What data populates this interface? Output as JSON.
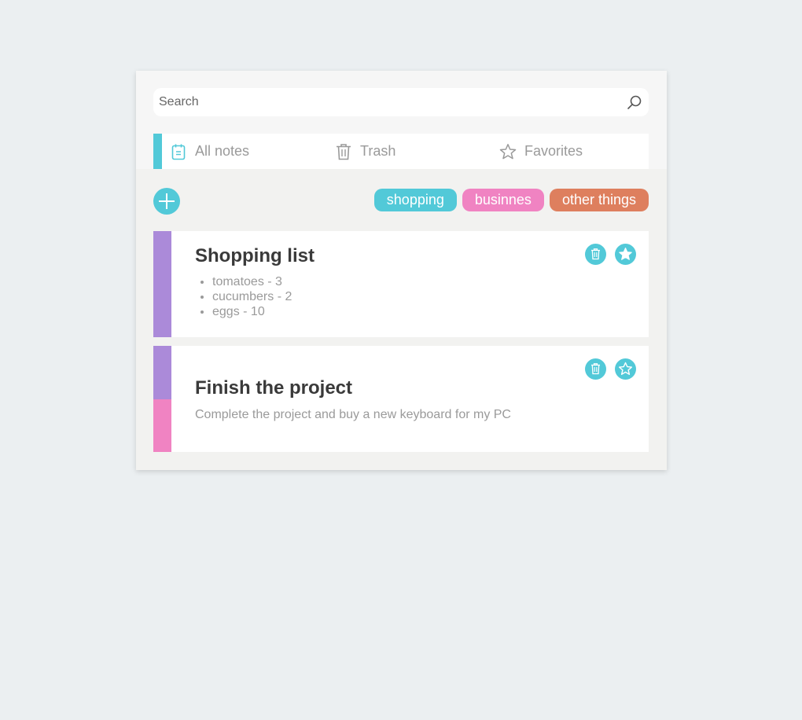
{
  "search": {
    "placeholder": "Search",
    "icon": "search-icon"
  },
  "nav": {
    "items": [
      {
        "label": "All notes",
        "icon": "notepad-icon",
        "active": true
      },
      {
        "label": "Trash",
        "icon": "trash-icon",
        "active": false
      },
      {
        "label": "Favorites",
        "icon": "star-icon",
        "active": false
      }
    ]
  },
  "toolbar": {
    "add_icon": "plus-icon"
  },
  "tags": [
    {
      "label": "shopping",
      "color": "#52c9d8"
    },
    {
      "label": "businnes",
      "color": "#f083c2"
    },
    {
      "label": "other things",
      "color": "#de7f5e"
    }
  ],
  "notes": [
    {
      "title": "Shopping list",
      "items": [
        "tomatoes - 3",
        "cucumbers - 2",
        "eggs - 10"
      ],
      "strip_colors": [
        "#ab8ad9"
      ],
      "favorite": true
    },
    {
      "title": "Finish the project",
      "text": "Complete the project and buy a new keyboard for my PC",
      "strip_colors": [
        "#ab8ad9",
        "#f083c2"
      ],
      "favorite": false
    }
  ],
  "colors": {
    "accent": "#52c9d8",
    "purple": "#ab8ad9",
    "pink": "#f083c2",
    "orange": "#de7f5e",
    "background": "#ebeff1"
  }
}
